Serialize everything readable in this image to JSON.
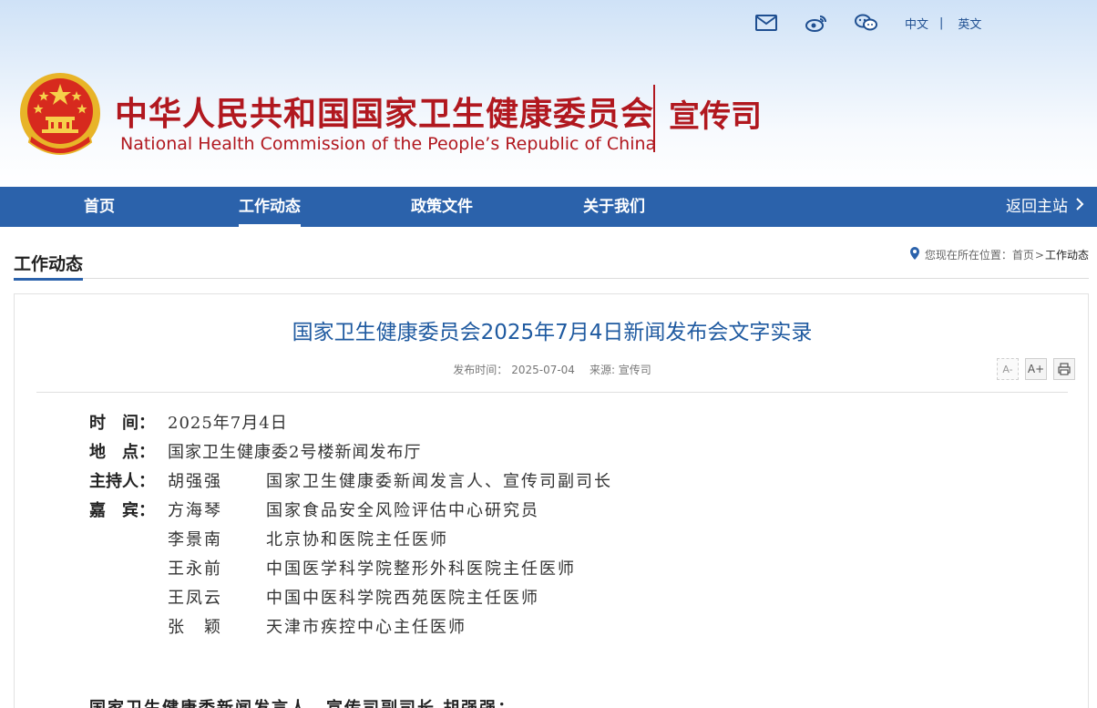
{
  "header": {
    "top_links": {
      "icons": [
        "mail-icon",
        "weibo-icon",
        "wechat-icon"
      ],
      "lang_cn": "中文",
      "lang_sep": "|",
      "lang_en": "英文"
    },
    "title_cn": "中华人民共和国国家卫生健康委员会",
    "title_en": "National Health Commission of the People’s  Republic of China",
    "department": "宣传司",
    "brand_color": "#b1181f"
  },
  "nav": {
    "items": [
      {
        "label": "首页",
        "active": false
      },
      {
        "label": "工作动态",
        "active": true
      },
      {
        "label": "政策文件",
        "active": false
      },
      {
        "label": "关于我们",
        "active": false
      }
    ],
    "back_label": "返回主站",
    "back_icon": "chevron-right-icon",
    "color": "#2b62ab"
  },
  "section": {
    "title": "工作动态",
    "breadcrumb": {
      "prefix": "您现在所在位置：",
      "home": "首页",
      "sep": ">",
      "current": "工作动态"
    }
  },
  "article": {
    "title": "国家卫生健康委员会2025年7月4日新闻发布会文字实录",
    "meta": {
      "date_label": "发布时间：",
      "date": "2025-07-04",
      "source": "来源: 宣传司"
    },
    "tools": {
      "font_smaller": "A-",
      "font_larger": "A+",
      "print_icon": "printer-icon"
    },
    "info": {
      "time_label": "时　间：",
      "time_value": "2025年7月4日",
      "place_label": "地　点：",
      "place_value": "国家卫生健康委2号楼新闻发布厅",
      "host_label": "主持人：",
      "host_name": "胡强强",
      "host_role": "国家卫生健康委新闻发言人、宣传司副司长",
      "guests_label": "嘉　宾：",
      "guests": [
        {
          "name": "方海琴",
          "role": "国家食品安全风险评估中心研究员"
        },
        {
          "name": "李景南",
          "role": "北京协和医院主任医师"
        },
        {
          "name": "王永前",
          "role": "中国医学科学院整形外科医院主任医师"
        },
        {
          "name": "王凤云",
          "role": "中国中医科学院西苑医院主任医师"
        },
        {
          "name": "张　颖",
          "role": "天津市疾控中心主任医师"
        }
      ]
    },
    "first_paragraph": "国家卫生健康委新闻发言人、宣传司副司长 胡强强："
  }
}
